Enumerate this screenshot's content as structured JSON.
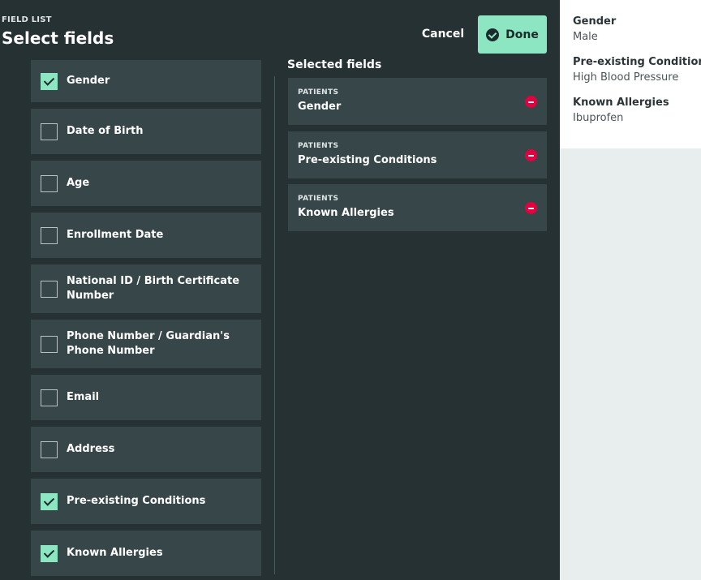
{
  "header": {
    "eyebrow": "FIELD LIST",
    "title": "Select fields",
    "cancel_label": "Cancel",
    "done_label": "Done"
  },
  "field_list": {
    "items": [
      {
        "label": "Gender",
        "checked": true
      },
      {
        "label": "Date of Birth",
        "checked": false
      },
      {
        "label": "Age",
        "checked": false
      },
      {
        "label": "Enrollment Date",
        "checked": false
      },
      {
        "label": "National ID / Birth Certificate Number",
        "checked": false
      },
      {
        "label": "Phone Number / Guardian's Phone Number",
        "checked": false
      },
      {
        "label": "Email",
        "checked": false
      },
      {
        "label": "Address",
        "checked": false
      },
      {
        "label": "Pre-existing Conditions",
        "checked": true
      },
      {
        "label": "Known Allergies",
        "checked": true
      }
    ]
  },
  "selected": {
    "heading": "Selected fields",
    "items": [
      {
        "category": "PATIENTS",
        "name": "Gender"
      },
      {
        "category": "PATIENTS",
        "name": "Pre-existing Conditions"
      },
      {
        "category": "PATIENTS",
        "name": "Known Allergies"
      }
    ]
  },
  "preview": {
    "fields": [
      {
        "label": "Gender",
        "value": "Male"
      },
      {
        "label": "Pre-existing Conditions",
        "value": "High Blood Pressure"
      },
      {
        "label": "Known Allergies",
        "value": "Ibuprofen"
      }
    ]
  },
  "colors": {
    "panel_bg": "#263134",
    "item_bg": "#374649",
    "accent": "#8ce6c1",
    "remove": "#e3003f"
  }
}
